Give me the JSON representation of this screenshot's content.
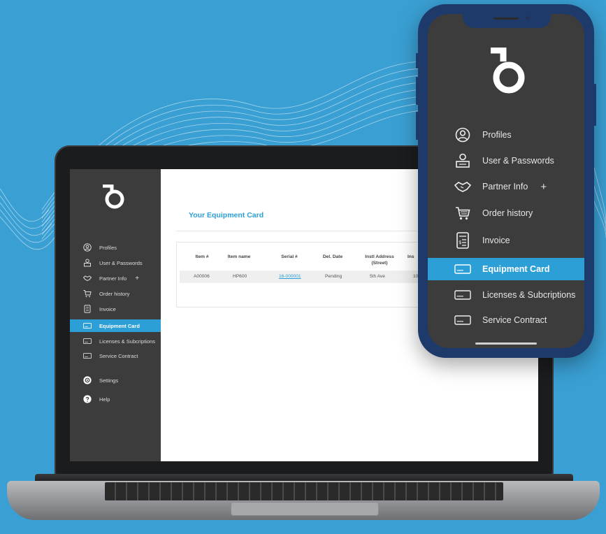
{
  "colors": {
    "background": "#3a9fd3",
    "accent": "#2c9fd6",
    "sidebar": "#3c3c3c"
  },
  "laptop": {
    "sidebar": {
      "logo": "b-logo",
      "items": [
        {
          "label": "Profiles",
          "icon": "profile-icon"
        },
        {
          "label": "User & Passwords",
          "icon": "user-lock-icon"
        },
        {
          "label": "Partner Info",
          "icon": "handshake-icon",
          "extra": "+"
        },
        {
          "label": "Order history",
          "icon": "cart-icon"
        },
        {
          "label": "Invoice",
          "icon": "invoice-icon"
        },
        {
          "label": "Equipment Card",
          "icon": "card-icon",
          "active": true
        },
        {
          "label": "Licenses & Subcriptions",
          "icon": "card-icon"
        },
        {
          "label": "Service Contract",
          "icon": "card-icon"
        },
        {
          "label": "Settings",
          "icon": "gear-icon"
        },
        {
          "label": "Help",
          "icon": "help-icon"
        }
      ]
    },
    "main": {
      "title": "Your Equipment Card",
      "table": {
        "headers": [
          "Item #",
          "Item name",
          "Serial #",
          "Del. Date",
          "Instl Address (Street)",
          "Ins"
        ],
        "rows": [
          [
            "A00006",
            "HP600",
            "16-000001",
            "Pending",
            "5th Ave",
            "100"
          ]
        ]
      }
    }
  },
  "phone": {
    "items": [
      {
        "label": "Profiles",
        "icon": "profile-icon"
      },
      {
        "label": "User & Passwords",
        "icon": "user-lock-icon"
      },
      {
        "label": "Partner Info",
        "icon": "handshake-icon",
        "extra": "+"
      },
      {
        "label": "Order history",
        "icon": "cart-icon"
      },
      {
        "label": "Invoice",
        "icon": "invoice-icon"
      },
      {
        "label": "Equipment Card",
        "icon": "card-icon",
        "active": true
      },
      {
        "label": "Licenses & Subcriptions",
        "icon": "card-icon"
      },
      {
        "label": "Service Contract",
        "icon": "card-icon"
      }
    ]
  }
}
